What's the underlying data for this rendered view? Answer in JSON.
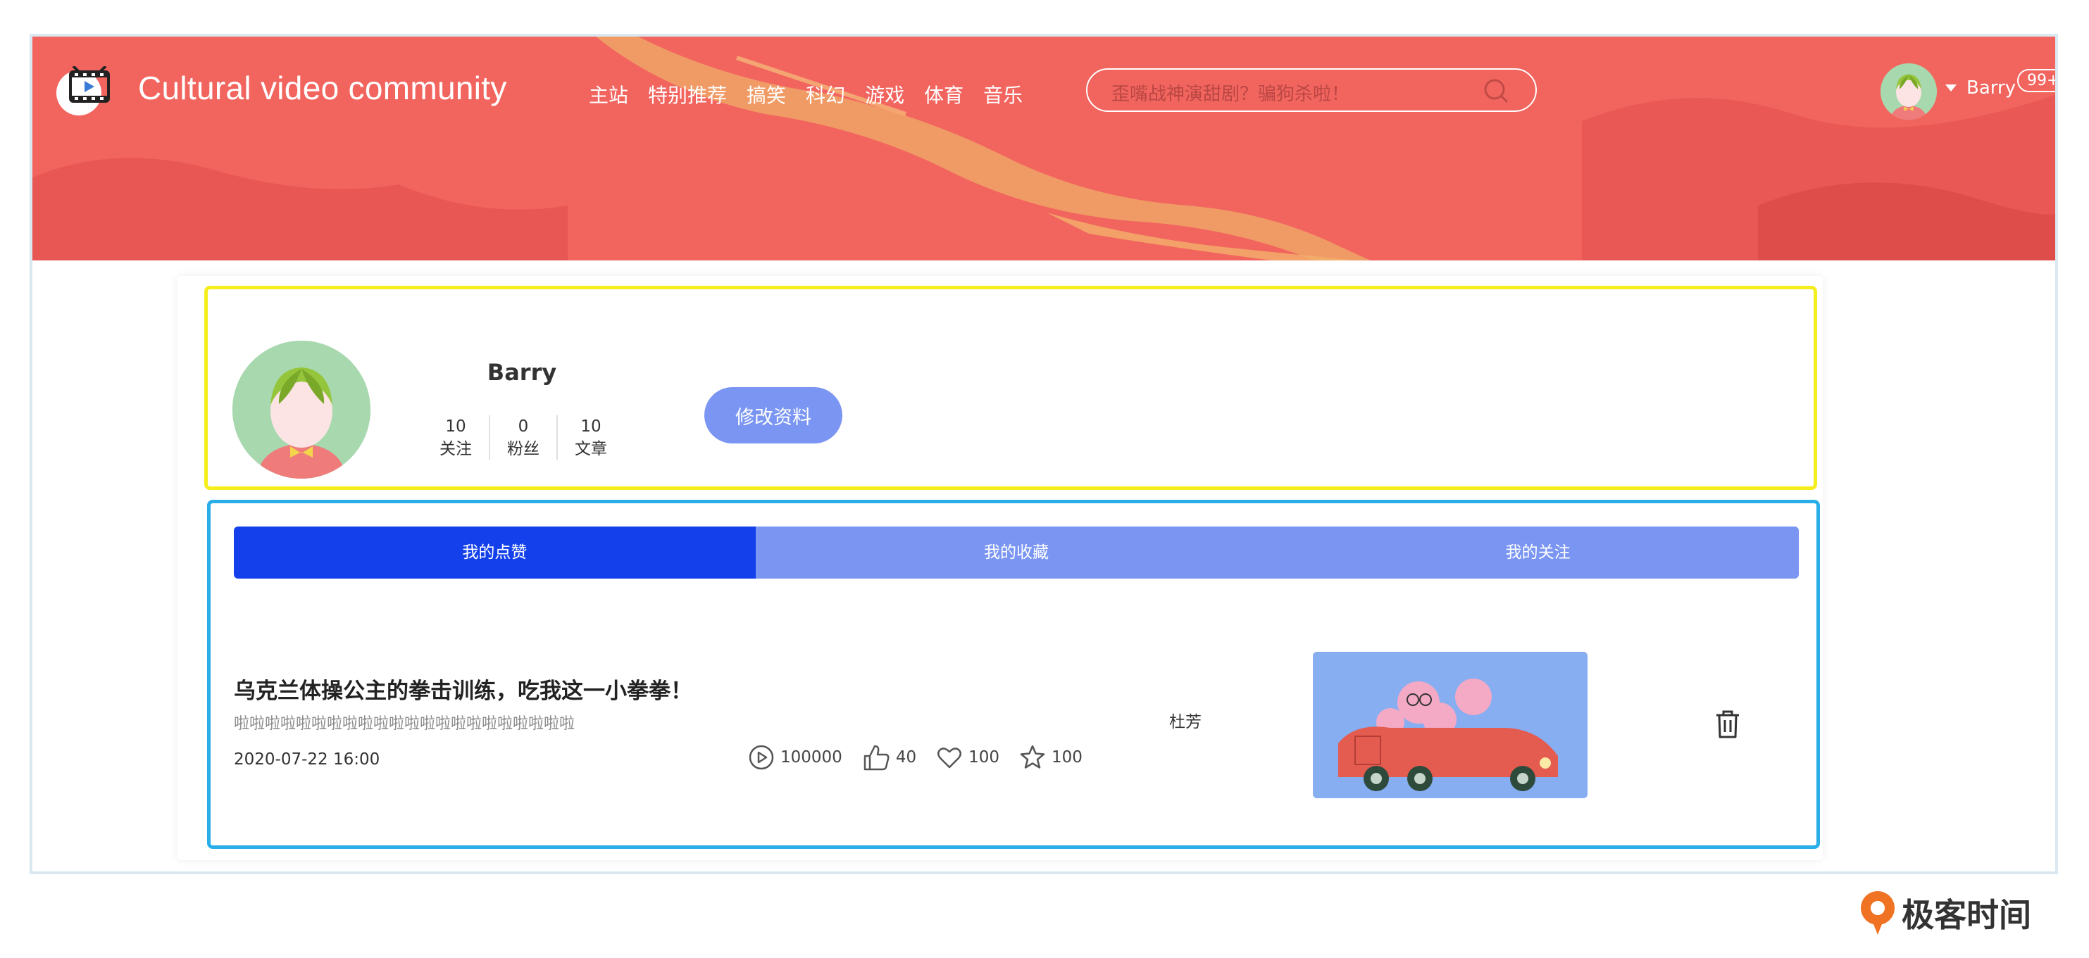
{
  "header": {
    "site_title": "Cultural video community",
    "nav": [
      "主站",
      "特别推荐",
      "搞笑",
      "科幻",
      "游戏",
      "体育",
      "音乐"
    ],
    "search": {
      "placeholder": "歪嘴战神演甜剧？骗狗杀啦！"
    },
    "user": {
      "name": "Barry",
      "badge": "99+"
    }
  },
  "profile": {
    "name": "Barry",
    "stats": [
      {
        "value": "10",
        "label": "关注"
      },
      {
        "value": "0",
        "label": "粉丝"
      },
      {
        "value": "10",
        "label": "文章"
      }
    ],
    "edit_label": "修改资料"
  },
  "tabs": [
    {
      "label": "我的点赞",
      "active": true
    },
    {
      "label": "我的收藏",
      "active": false
    },
    {
      "label": "我的关注",
      "active": false
    }
  ],
  "item": {
    "title": "乌克兰体操公主的拳击训练，吃我这一小拳拳！",
    "desc": "啦啦啦啦啦啦啦啦啦啦啦啦啦啦啦啦啦啦啦啦啦啦",
    "date": "2020-07-22 16:00",
    "plays": "100000",
    "likes": "40",
    "favorites": "100",
    "stars": "100",
    "author": "杜芳"
  },
  "footer": {
    "brand": "极客时间"
  },
  "colors": {
    "banner": "#f2655f",
    "tab_active": "#1340eb",
    "tab_inactive": "#7a95f2",
    "edit_button": "#7b96f2",
    "highlight_profile": "#f4ee1d",
    "highlight_list": "#29aee8"
  }
}
